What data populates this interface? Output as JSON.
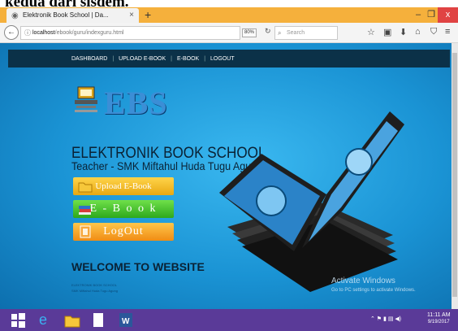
{
  "caption": "kedua dari sisdem.",
  "browser": {
    "tab_title": "Elektronik Book School | Da...",
    "tab_close": "×",
    "new_tab": "+",
    "url_host": "localhost",
    "url_path": "/ebook/guru/indexguru.html",
    "zoom": "80%",
    "search_placeholder": "Search",
    "window_minimize": "–",
    "window_maximize": "❐",
    "window_close": "x"
  },
  "site": {
    "nav": [
      "DASHBOARD",
      "UPLOAD E-BOOK",
      "E-BOOK",
      "LOGOUT"
    ],
    "logo": "EBS",
    "title": "ELEKTRONIK BOOK SCHOOL",
    "subtitle": "Teacher - SMK Miftahul Huda Tugu Agung",
    "buttons": {
      "upload": "Upload E-Book",
      "ebook": "E - B o o k",
      "logout": "LogOut"
    },
    "welcome": "WELCOME TO WEBSITE",
    "footnote_1": "ELEKTRONIK BOOK SCHOOL",
    "footnote_2": "SMK Miftahul Huda Tugu Agung"
  },
  "watermark": {
    "line1": "Activate Windows",
    "line2": "Go to PC settings to activate Windows."
  },
  "taskbar": {
    "time": "11:11 AM",
    "date": "9/19/2017"
  },
  "icons": [
    "firefox-icon",
    "reload-icon",
    "search-icon",
    "star-icon",
    "clipboard-icon",
    "download-icon",
    "home-icon",
    "pocket-icon",
    "menu-icon",
    "windows-icon",
    "ie-icon",
    "explorer-icon",
    "word-icon"
  ]
}
